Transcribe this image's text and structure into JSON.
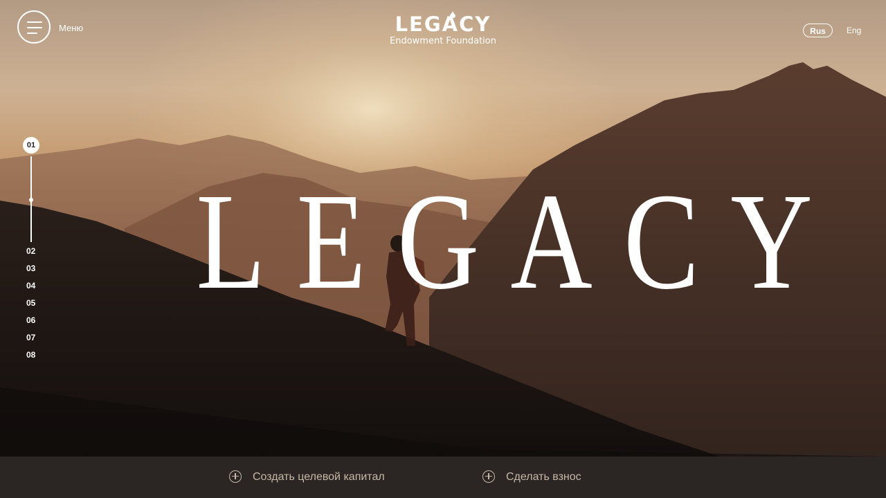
{
  "header": {
    "menu_label": "Меню",
    "logo_word": "LEGACY",
    "logo_sub": "Endowment Foundation",
    "languages": [
      "Rus",
      "Eng"
    ],
    "active_language": "Rus"
  },
  "slide_nav": {
    "current": "01",
    "items": [
      "02",
      "03",
      "04",
      "05",
      "06",
      "07",
      "08"
    ]
  },
  "hero": {
    "title": "LEGACY"
  },
  "actions": {
    "create_capital": "Создать целевой капитал",
    "make_donation": "Сделать взнос"
  },
  "colors": {
    "text": "#ffffff",
    "bottom_bar": "#2b2624",
    "action_text": "#c8b8a6",
    "sky": "#c9a27e",
    "mountain": "#3b2a22"
  },
  "icons": {
    "menu": "hamburger-icon",
    "action": "plus-circle-icon",
    "logo_drop": "drop-icon"
  }
}
